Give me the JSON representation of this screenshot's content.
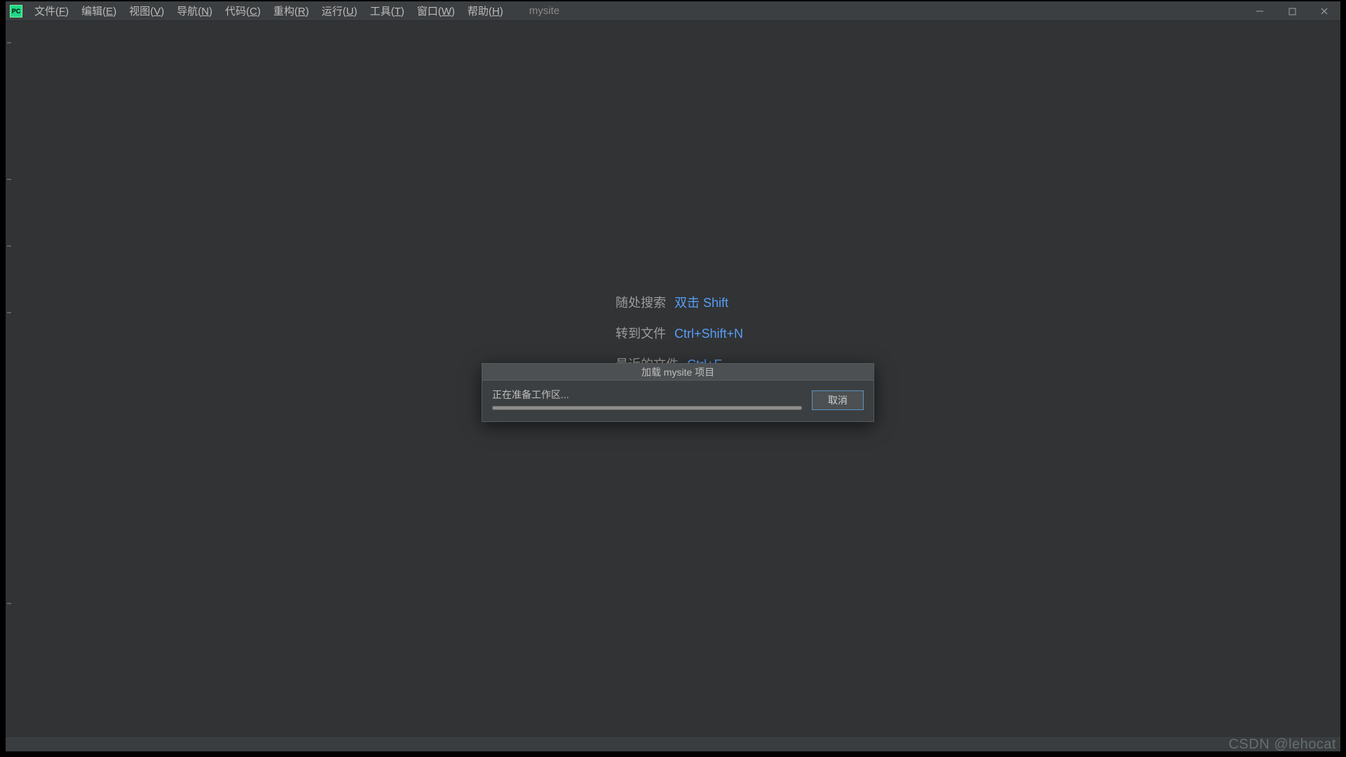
{
  "app_icon_text": "PC",
  "menubar": {
    "items": [
      {
        "text": "文件",
        "mn": "F"
      },
      {
        "text": "编辑",
        "mn": "E"
      },
      {
        "text": "视图",
        "mn": "V"
      },
      {
        "text": "导航",
        "mn": "N"
      },
      {
        "text": "代码",
        "mn": "C"
      },
      {
        "text": "重构",
        "mn": "R"
      },
      {
        "text": "运行",
        "mn": "U"
      },
      {
        "text": "工具",
        "mn": "T"
      },
      {
        "text": "窗口",
        "mn": "W"
      },
      {
        "text": "帮助",
        "mn": "H"
      }
    ],
    "project": "mysite"
  },
  "hints": [
    {
      "label": "随处搜索",
      "shortcut": "双击 Shift"
    },
    {
      "label": "转到文件",
      "shortcut": "Ctrl+Shift+N"
    },
    {
      "label": "最近的文件",
      "shortcut": "Ctrl+E"
    }
  ],
  "dialog": {
    "title": "加载 mysite 项目",
    "progress_text": "正在准备工作区...",
    "cancel_label": "取消"
  },
  "watermark": "CSDN @lehocat"
}
